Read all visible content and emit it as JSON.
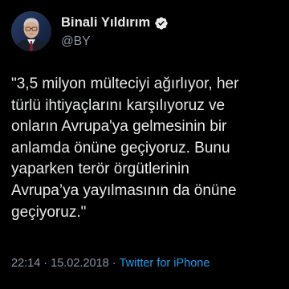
{
  "author": {
    "display_name": "Binali Yıldırım",
    "handle": "@BY",
    "verified": true,
    "verified_badge_icon": "verified-badge-icon",
    "avatar_icon": "avatar"
  },
  "tweet": {
    "text": "\"3,5 milyon mülteciyi ağırlıyor, her\ntürlü ihtiyaçlarını karşılıyoruz ve\nonların Avrupa'ya gelmesinin bir\nanlamda önüne geçiyoruz. Bunu\nyaparken terör örgütlerinin\nAvrupa’ya yayılmasının da önüne\ngeçiyoruz.\""
  },
  "meta": {
    "time": "22:14",
    "separator": "·",
    "date": "15.02.2018",
    "source": "Twitter for iPhone"
  },
  "colors": {
    "background": "#000000",
    "text": "#e7e9ea",
    "secondary_text": "#8b98a5",
    "accent": "#1d9bf0"
  }
}
